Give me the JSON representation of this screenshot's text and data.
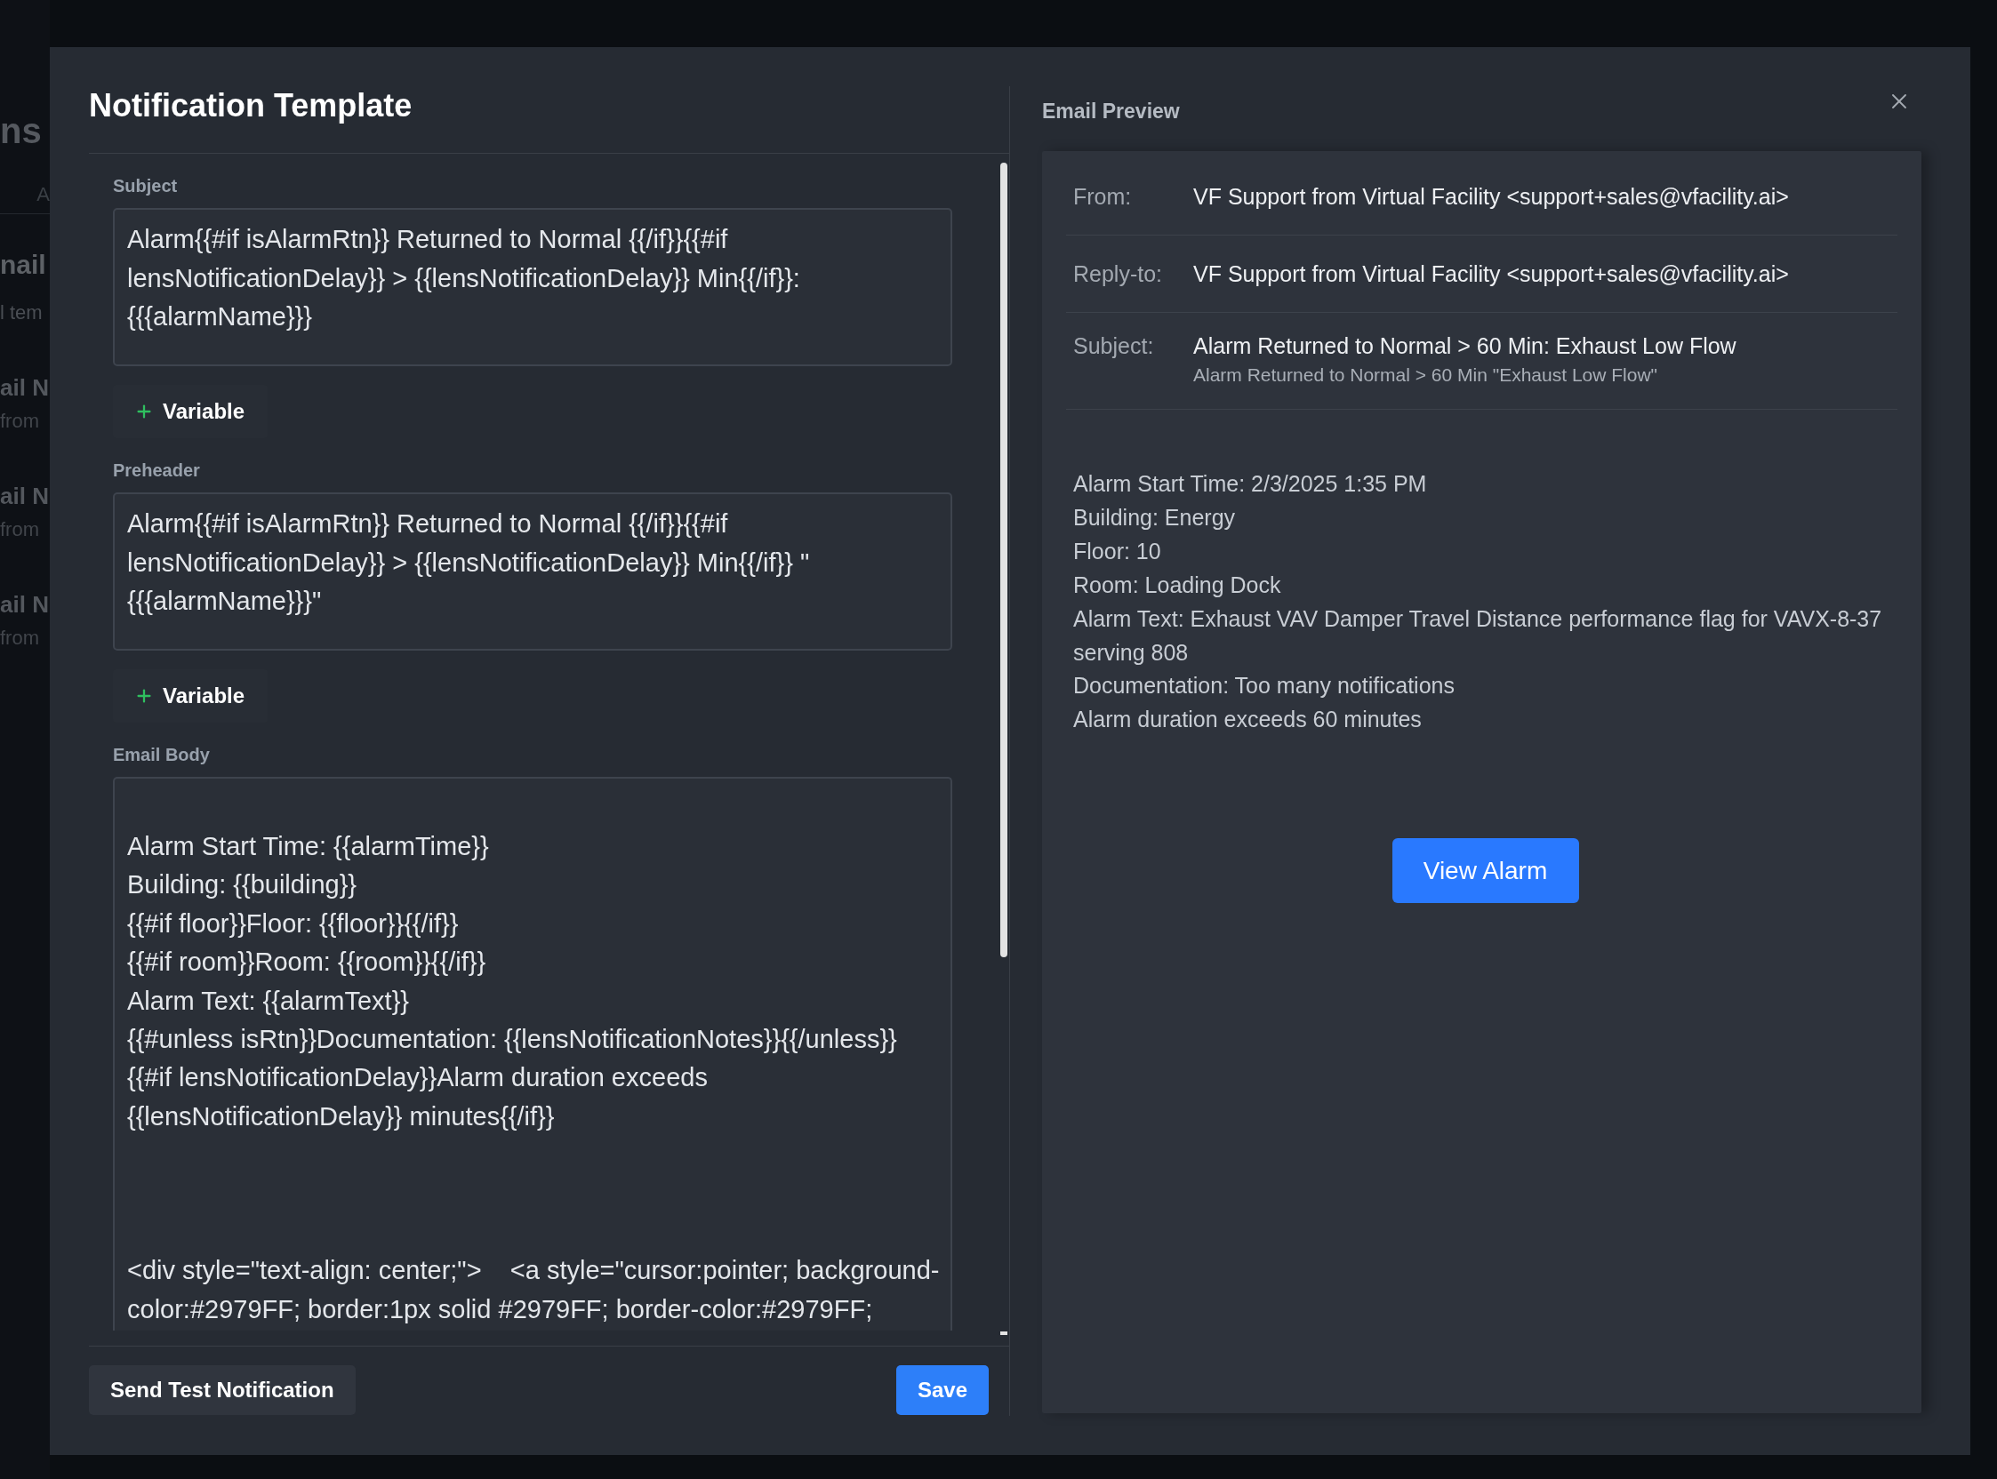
{
  "background_page": {
    "heading": "ns",
    "tab": "A",
    "section": {
      "title": "nail",
      "description": "l tem"
    },
    "items": [
      {
        "title": "ail N",
        "subtitle": "from"
      },
      {
        "title": "ail N",
        "subtitle": "from"
      },
      {
        "title": "ail N",
        "subtitle": "from"
      }
    ]
  },
  "dialog": {
    "title": "Notification Template",
    "subject": {
      "label": "Subject",
      "lines": [
        "Alarm{{#if isAlarmRtn}} Returned to Normal {{/if}}{{#if",
        "lensNotificationDelay}} > {{lensNotificationDelay}} Min{{/if}}:",
        "{{{alarmName}}}"
      ],
      "add_button": "Variable"
    },
    "preheader": {
      "label": "Preheader",
      "lines": [
        "Alarm{{#if isAlarmRtn}} Returned to Normal {{/if}}{{#if",
        "lensNotificationDelay}} > {{lensNotificationDelay}} Min{{/if}} \"",
        "{{{alarmName}}}\""
      ],
      "add_button": "Variable"
    },
    "email_body": {
      "label": "Email Body",
      "blocks": [
        [
          "Alarm Start Time: {{alarmTime}}",
          "Building: {{building}}",
          "{{#if floor}}Floor: {{floor}}{{/if}}",
          "{{#if room}}Room: {{room}}{{/if}}",
          "Alarm Text: {{alarmText}}",
          "{{#unless isRtn}}Documentation: {{lensNotificationNotes}}{{/unless}}",
          "{{#if lensNotificationDelay}}Alarm duration exceeds",
          "{{lensNotificationDelay}} minutes{{/if}}"
        ],
        [
          "<div style=\"text-align: center;\">    <a style=\"cursor:pointer; background-",
          "color:#2979FF; border:1px solid #2979FF; border-color:#2979FF;"
        ]
      ]
    },
    "footer_buttons": [
      {
        "label": "Send Test Notification",
        "kind": "secondary"
      },
      {
        "label": "Save",
        "kind": "primary"
      }
    ]
  },
  "preview": {
    "title": "Email Preview",
    "headers": [
      {
        "label": "From:",
        "value": "VF Support from Virtual Facility <support+sales@vfacility.ai>"
      },
      {
        "label": "Reply-to:",
        "value": "VF Support from Virtual Facility <support+sales@vfacility.ai>"
      },
      {
        "label": "Subject:",
        "value": "Alarm Returned to Normal > 60 Min: Exhaust Low Flow",
        "preheader": "Alarm Returned to Normal > 60 Min \"Exhaust Low Flow\""
      }
    ],
    "body_lines": [
      "Alarm Start Time: 2/3/2025 1:35 PM",
      "Building: Energy",
      "Floor: 10",
      "Room: Loading Dock",
      "Alarm Text: Exhaust VAV Damper Travel Distance performance flag for VAVX-8-37 serving 808",
      "Documentation: Too many notifications",
      "Alarm duration exceeds 60 minutes"
    ],
    "action_button": "View Alarm"
  }
}
